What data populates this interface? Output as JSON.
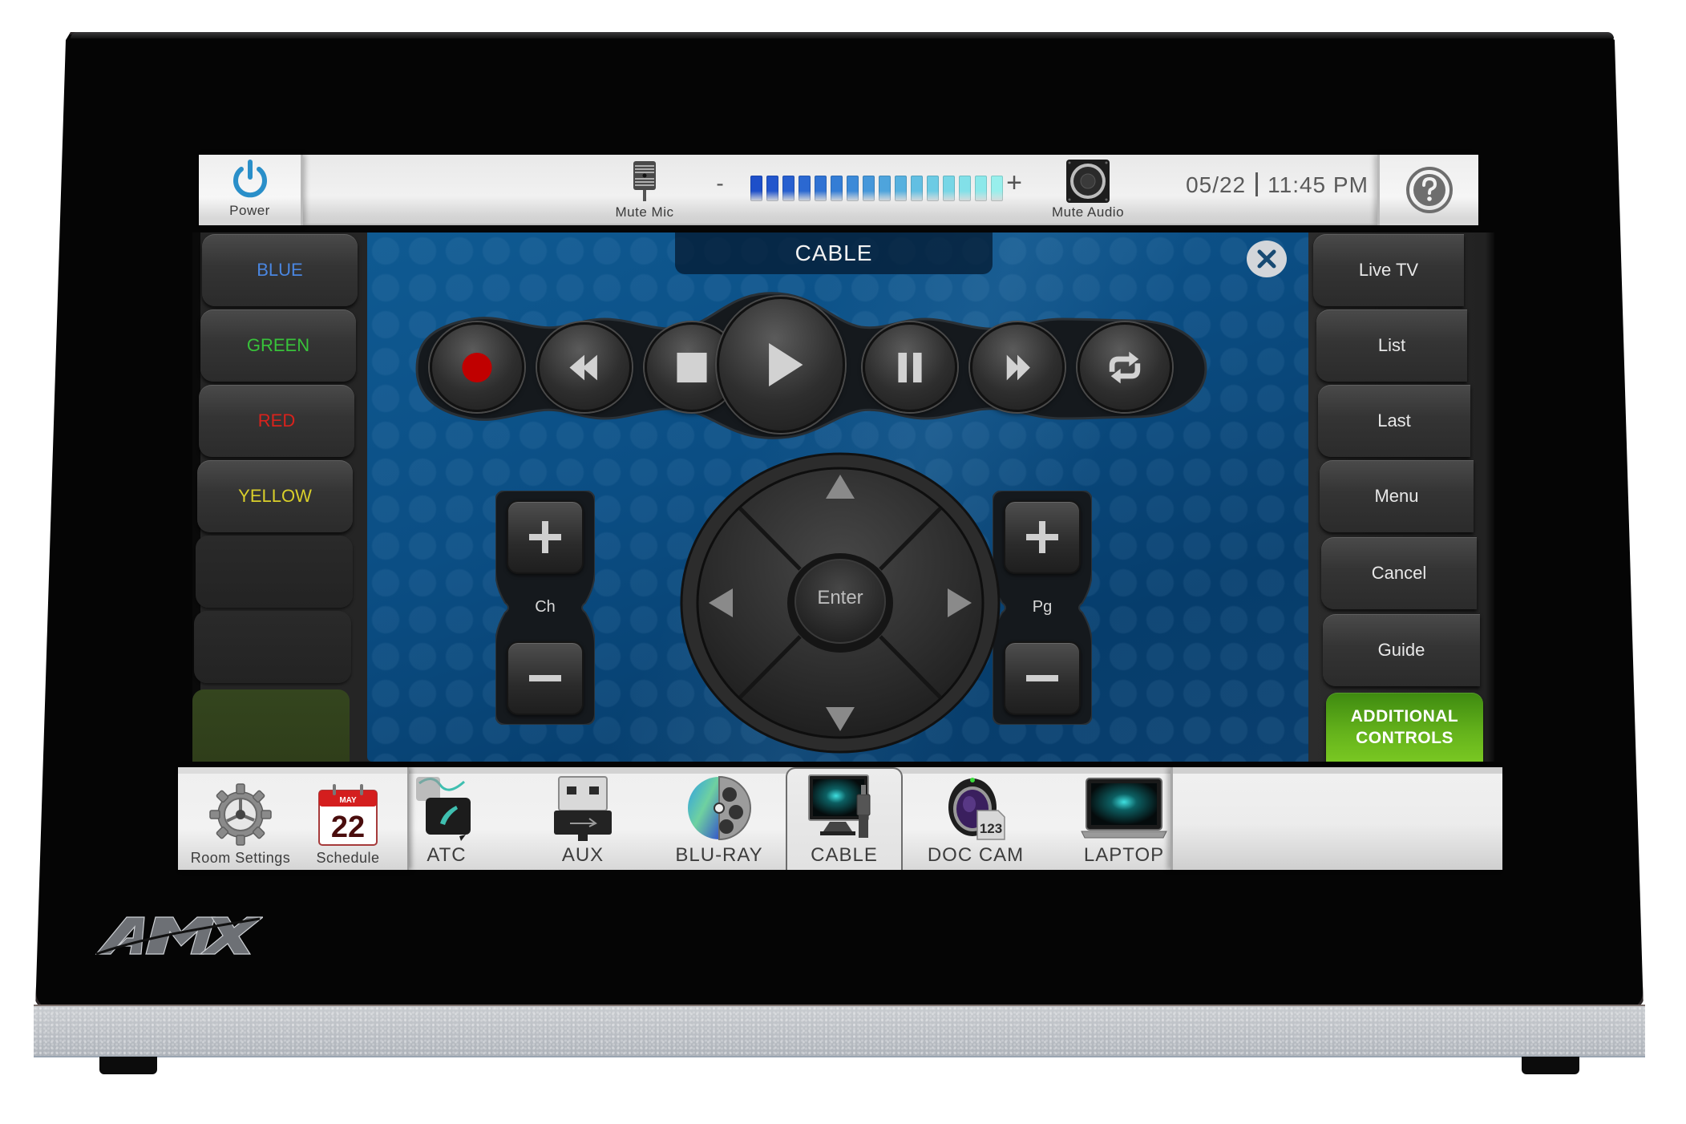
{
  "brand": "AMX",
  "topbar": {
    "power_label": "Power",
    "mute_mic_label": "Mute Mic",
    "volume_minus": "-",
    "volume_plus": "+",
    "volume_level": {
      "filled_segments": 16,
      "total_segments": 16
    },
    "volume_colors": [
      "#1e4fc9",
      "#2356cc",
      "#275fcf",
      "#2b68d1",
      "#3072d3",
      "#347dd5",
      "#3c8ad8",
      "#4597da",
      "#4ea4dc",
      "#57b1df",
      "#62bfe2",
      "#6ccbe4",
      "#77d6e6",
      "#82e0e8",
      "#8ce8ea",
      "#98efec"
    ],
    "mute_audio_label": "Mute Audio",
    "date": "05/22",
    "time": "11:45 PM",
    "help_icon": "question-circle-icon"
  },
  "main": {
    "title": "CABLE",
    "close_icon": "close-x-icon",
    "transport": [
      {
        "name": "record",
        "icon": "record-icon"
      },
      {
        "name": "rewind",
        "icon": "rewind-icon"
      },
      {
        "name": "stop",
        "icon": "stop-icon"
      },
      {
        "name": "play",
        "icon": "play-icon"
      },
      {
        "name": "pause",
        "icon": "pause-icon"
      },
      {
        "name": "fast-forward",
        "icon": "fast-forward-icon"
      },
      {
        "name": "repeat",
        "icon": "repeat-icon"
      }
    ],
    "channel_label": "Ch",
    "page_label": "Pg",
    "enter_label": "Enter",
    "colors": {
      "record": "#c00000",
      "accent_green": "#66b41c"
    }
  },
  "left_column": {
    "buttons": [
      {
        "label": "BLUE",
        "color": "#4a86e0"
      },
      {
        "label": "GREEN",
        "color": "#38c23a"
      },
      {
        "label": "RED",
        "color": "#d9221c"
      },
      {
        "label": "YELLOW",
        "color": "#d9cf2a"
      }
    ]
  },
  "right_column": {
    "buttons": [
      {
        "label": "Live TV"
      },
      {
        "label": "List"
      },
      {
        "label": "Last"
      },
      {
        "label": "Menu"
      },
      {
        "label": "Cancel"
      },
      {
        "label": "Guide"
      }
    ],
    "additional_line1": "ADDITIONAL",
    "additional_line2": "CONTROLS"
  },
  "bottombar": {
    "room_settings_label": "Room Settings",
    "schedule_label": "Schedule",
    "calendar_month": "MAY",
    "calendar_day": "22",
    "sources": [
      {
        "label": "ATC",
        "icon": "phone-icon"
      },
      {
        "label": "AUX",
        "icon": "usb-icon"
      },
      {
        "label": "BLU-RAY",
        "icon": "bluray-disc-icon"
      },
      {
        "label": "CABLE",
        "icon": "cable-tv-icon",
        "selected": true
      },
      {
        "label": "DOC CAM",
        "icon": "document-camera-icon",
        "badge": "123"
      },
      {
        "label": "LAPTOP",
        "icon": "laptop-icon"
      }
    ]
  }
}
